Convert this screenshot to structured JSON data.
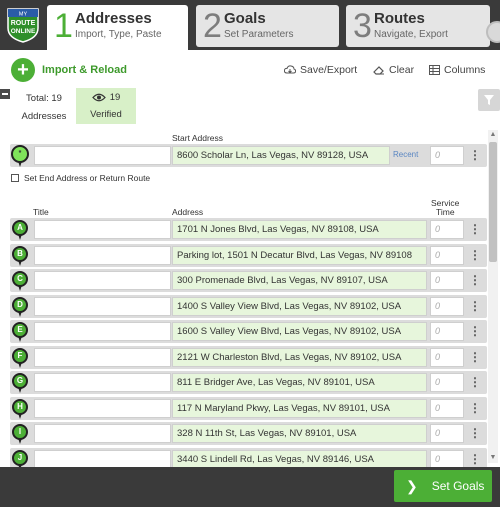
{
  "logo": {
    "line1": "MY",
    "line2": "ROUTE",
    "line3": "ONLINE"
  },
  "tabs": [
    {
      "num": "1",
      "title": "Addresses",
      "subtitle": "Import, Type, Paste"
    },
    {
      "num": "2",
      "title": "Goals",
      "subtitle": "Set Parameters"
    },
    {
      "num": "3",
      "title": "Routes",
      "subtitle": "Navigate, Export"
    }
  ],
  "toolbar": {
    "import_label": "Import & Reload",
    "save_export": "Save/Export",
    "clear": "Clear",
    "columns": "Columns"
  },
  "summary": {
    "total_label": "Total: 19",
    "addresses_label": "Addresses",
    "verified_count": "19",
    "verified_label": "Verified"
  },
  "start": {
    "header": "Start Address",
    "address": "8600 Scholar Ln, Las Vegas, NV 89128, USA",
    "recent": "Recent",
    "service": "0",
    "pin_label": "*"
  },
  "end_option": "Set End Address or Return Route",
  "columns_header": {
    "title": "Title",
    "address": "Address",
    "service_l1": "Service",
    "service_l2": "Time"
  },
  "rows": [
    {
      "pin": "A",
      "address": "1701 N Jones Blvd, Las Vegas, NV 89108, USA",
      "service": "0"
    },
    {
      "pin": "B",
      "address": "Parking lot, 1501 N Decatur Blvd, Las Vegas, NV 89108",
      "service": "0"
    },
    {
      "pin": "C",
      "address": "300 Promenade Blvd, Las Vegas, NV 89107, USA",
      "service": "0"
    },
    {
      "pin": "D",
      "address": "1400 S Valley View Blvd, Las Vegas, NV 89102, USA",
      "service": "0"
    },
    {
      "pin": "E",
      "address": "1600 S Valley View Blvd, Las Vegas, NV 89102, USA",
      "service": "0"
    },
    {
      "pin": "F",
      "address": "2121 W Charleston Blvd, Las Vegas, NV 89102, USA",
      "service": "0"
    },
    {
      "pin": "G",
      "address": "811 E Bridger Ave, Las Vegas, NV 89101, USA",
      "service": "0"
    },
    {
      "pin": "H",
      "address": "117 N Maryland Pkwy, Las Vegas, NV 89101, USA",
      "service": "0"
    },
    {
      "pin": "I",
      "address": "328 N 11th St, Las Vegas, NV 89101, USA",
      "service": "0"
    },
    {
      "pin": "J",
      "address": "3440 S Lindell Rd, Las Vegas, NV 89146, USA",
      "service": "0"
    }
  ],
  "footer": {
    "set_goals": "Set Goals"
  },
  "colors": {
    "accent": "#4caf36",
    "header_bg": "#3a3a3a",
    "verified_bg": "#d8f0c8",
    "address_bg": "#e7f6dc"
  }
}
